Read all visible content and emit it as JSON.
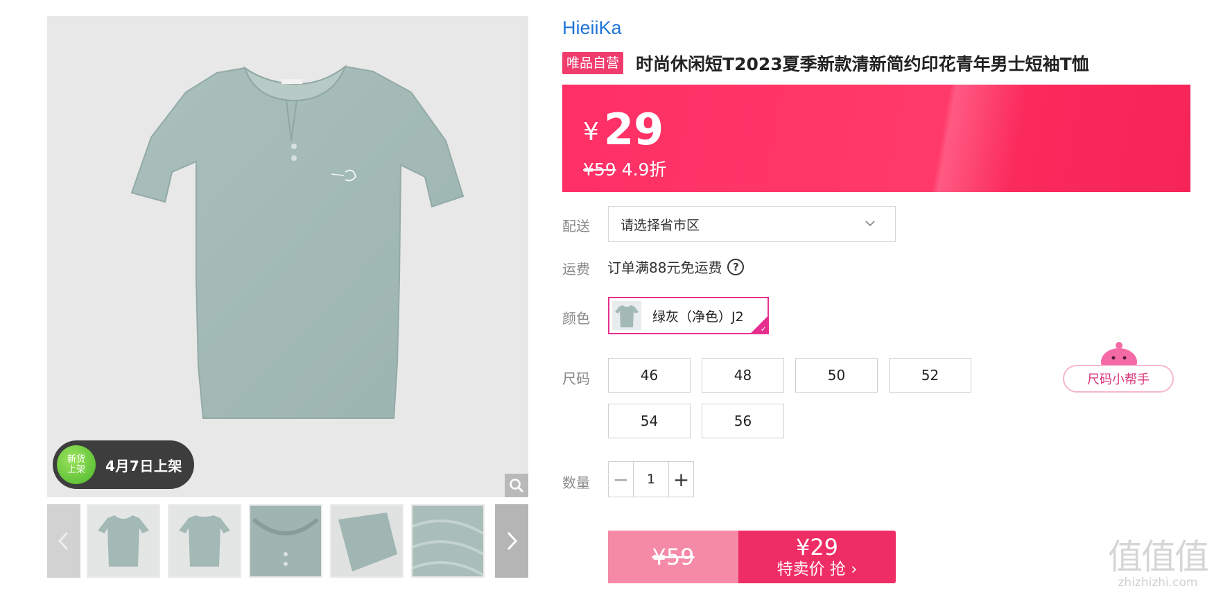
{
  "gallery": {
    "new_badge": {
      "line1": "新货",
      "line2": "上架",
      "date": "4月7日上架"
    }
  },
  "product": {
    "brand": "HieiiKa",
    "self_tag": "唯品自营",
    "title": "时尚休闲短T2023夏季新款清新简约印花青年男士短袖T恤"
  },
  "price": {
    "yen": "¥",
    "current": "29",
    "original": "¥59",
    "discount": "4.9折",
    "banner_color": "#ff2f65"
  },
  "delivery": {
    "label": "配送",
    "placeholder": "请选择省市区"
  },
  "shipping": {
    "label": "运费",
    "text": "订单满88元免运费",
    "help": "?"
  },
  "color": {
    "label": "颜色",
    "selected": "绿灰（净色）J2",
    "accent": "#e62e8e"
  },
  "size": {
    "label": "尺码",
    "options": [
      "46",
      "48",
      "50",
      "52",
      "54",
      "56"
    ],
    "helper": "尺码小帮手"
  },
  "quantity": {
    "label": "数量",
    "minus": "−",
    "value": "1",
    "plus": "+"
  },
  "buy": {
    "original_price": "¥59",
    "sale_price": "¥29",
    "cta": "特卖价 抢 ›"
  },
  "watermark": {
    "big": "值值值",
    "small": "zhizhizhi.com"
  }
}
